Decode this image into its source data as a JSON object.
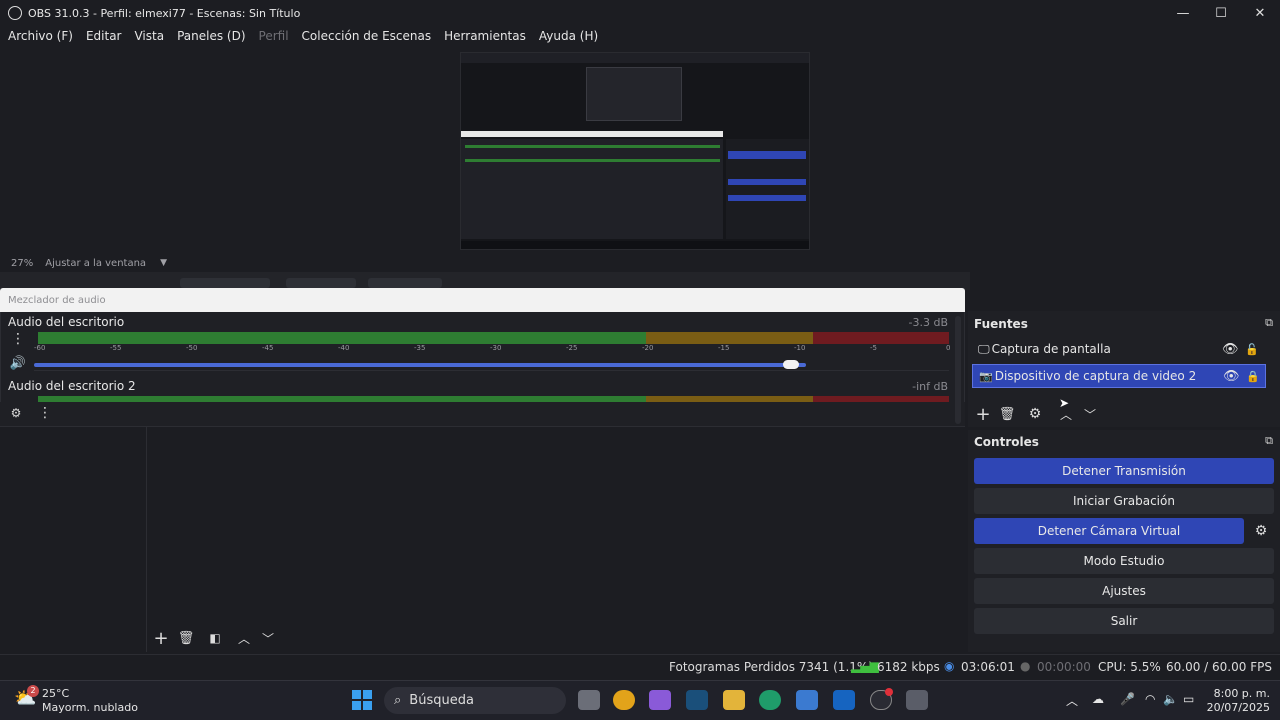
{
  "window": {
    "title": "OBS 31.0.3 - Perfil: elmexi77 - Escenas: Sin Título",
    "minimize": "—",
    "maximize": "☐",
    "close": "✕"
  },
  "menu": {
    "items": [
      "Archivo (F)",
      "Editar",
      "Vista",
      "Paneles (D)",
      "Perfil",
      "Colección de Escenas",
      "Herramientas",
      "Ayuda (H)"
    ]
  },
  "preview": {
    "zoom": "27%",
    "fit_label": "Ajustar a la ventana"
  },
  "mixer": {
    "title": "Mezclador de audio",
    "channels": [
      {
        "name": "Audio del escritorio",
        "db": "-3.3 dB",
        "volume": 0.98
      },
      {
        "name": "Audio del escritorio 2",
        "db": "-inf dB"
      }
    ],
    "ticks": [
      "-60",
      "-55",
      "-50",
      "-45",
      "-40",
      "-35",
      "-30",
      "-25",
      "-20",
      "-15",
      "-10",
      "-5",
      "0"
    ]
  },
  "sources": {
    "title": "Fuentes",
    "items": [
      {
        "label": "Captura de pantalla",
        "selected": false,
        "locked": false
      },
      {
        "label": "Dispositivo de captura de video 2",
        "selected": true,
        "locked": true
      }
    ]
  },
  "controls": {
    "title": "Controles",
    "stop_stream": "Detener Transmisión",
    "start_record": "Iniciar Grabación",
    "stop_virtualcam": "Detener Cámara Virtual",
    "studio_mode": "Modo Estudio",
    "settings": "Ajustes",
    "exit": "Salir"
  },
  "status": {
    "dropped_frames": "Fotogramas Perdidos 7341 (1.1%)",
    "bitrate": "6182 kbps",
    "stream_time": "03:06:01",
    "record_time": "00:00:00",
    "cpu": "CPU: 5.5%",
    "fps": "60.00 / 60.00 FPS"
  },
  "taskbar": {
    "weather_temp": "25°C",
    "weather_desc": "Mayorm. nublado",
    "weather_badge": "2",
    "search": "Búsqueda",
    "time": "8:00 p. m.",
    "date": "20/07/2025"
  },
  "colors": {
    "accent": "#2f46b5",
    "meter_green": "#2e7d32",
    "meter_yellow": "#7a5d14",
    "meter_red": "#6f1b20"
  }
}
